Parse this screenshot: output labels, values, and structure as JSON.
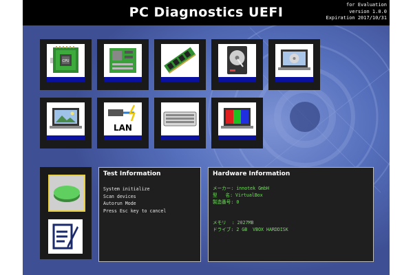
{
  "header": {
    "title": "PC Diagnostics UEFI",
    "eval_lines": [
      "for Evaluation",
      "version 1.0.0",
      "Expiration 2017/10/31"
    ]
  },
  "tiles": [
    {
      "name": "cpu",
      "icon": "cpu-icon",
      "label": "CPU"
    },
    {
      "name": "motherboard",
      "icon": "motherboard-icon"
    },
    {
      "name": "memory",
      "icon": "memory-icon"
    },
    {
      "name": "harddisk",
      "icon": "harddisk-icon"
    },
    {
      "name": "optical-drive",
      "icon": "laptop-optical-drive-icon"
    },
    {
      "name": "display",
      "icon": "laptop-display-icon"
    },
    {
      "name": "lan",
      "icon": "lan-icon",
      "label": "LAN"
    },
    {
      "name": "keyboard",
      "icon": "keyboard-icon"
    },
    {
      "name": "color-display",
      "icon": "laptop-color-bars-icon"
    }
  ],
  "sidebar": {
    "start_button_icon": "green-start-button-icon",
    "report_button_icon": "report-notepad-icon"
  },
  "test_info": {
    "title": "Test Information",
    "lines": [
      "System initialize",
      "Scan devices",
      "Autorun Mode",
      "Press Esc key to cancel"
    ]
  },
  "hardware_info": {
    "title": "Hardware Information",
    "lines": [
      "メーカー: innotek GmbH",
      "型   名: VirtualBox",
      "製造番号: 0",
      "",
      "",
      "メモリ  : 2027MB",
      "ドライブ: 2 GB  VBOX HARDDISK"
    ]
  },
  "colors": {
    "background_blue": "#4a5fa6",
    "tile_bar": "#0a10a0",
    "hardware_text": "#6fe05a",
    "panel_bg": "#1f1f1f"
  }
}
